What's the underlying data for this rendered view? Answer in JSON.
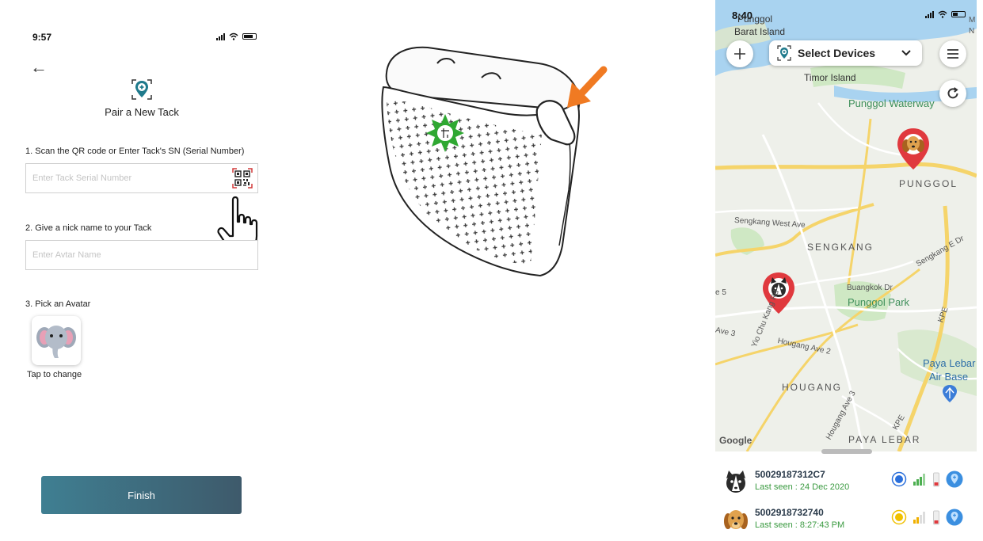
{
  "pair_screen": {
    "status_time": "9:57",
    "title": "Pair a New Tack",
    "step1_label": "1. Scan the QR code or Enter Tack's SN (Serial Number)",
    "serial_placeholder": "Enter Tack Serial Number",
    "step2_label": "2. Give a nick name to your Tack",
    "name_placeholder": "Enter Avtar Name",
    "step3_label": "3. Pick an Avatar",
    "avatar_caption": "Tap to change",
    "avatar_icon": "elephant-icon",
    "finish_label": "Finish"
  },
  "map_screen": {
    "status_time": "8:40",
    "select_devices": "Select Devices",
    "map_labels": {
      "punggol": "Punggol",
      "barat_island": "Barat Island",
      "timor_island": "Timor Island",
      "punggol_waterway": "Punggol Waterway",
      "punggol_area": "PUNGGOL",
      "sengkang": "SENGKANG",
      "punggol_park": "Punggol Park",
      "hougang": "HOUGANG",
      "paya_lebar_air_base": "Paya Lebar Air Base",
      "paya_lebar": "PAYA LEBAR",
      "sengkang_west": "Sengkang West Ave",
      "hougang_ave2": "Hougang Ave 2",
      "yio_chu_kang": "Yio Chu Kang Rd",
      "ave3": "Ave 3",
      "ave5": "e 5",
      "kpe": "KPE",
      "kpe2": "KPE",
      "hougang_ave3": "Hougang Ave 3",
      "buangkok": "Buangkok Dr",
      "sengkang_e_dr": "Sengkang E Dr",
      "google": "Google",
      "corner_m": "M",
      "corner_n": "N"
    },
    "devices": [
      {
        "id": "50029187312C7",
        "last_seen": "Last seen : 24 Dec 2020",
        "avatar": "dog-husky-icon",
        "status_color": "#2a6fdb"
      },
      {
        "id": "5002918732740",
        "last_seen": "Last seen : 8:27:43 PM",
        "avatar": "dog-golden-icon",
        "status_color": "#f0c000"
      }
    ]
  },
  "colors": {
    "finish_gradient_start": "#3f7f92",
    "finish_gradient_end": "#3e5a6b",
    "pin_red": "#e0393e",
    "map_water": "#a9d3f0",
    "map_land": "#eef0ea",
    "map_park": "#cfe8c4",
    "road_yellow": "#f5d46a",
    "accent_orange": "#f07a22",
    "sparkle_green": "#2fa832",
    "last_seen_green": "#3a9a40"
  }
}
